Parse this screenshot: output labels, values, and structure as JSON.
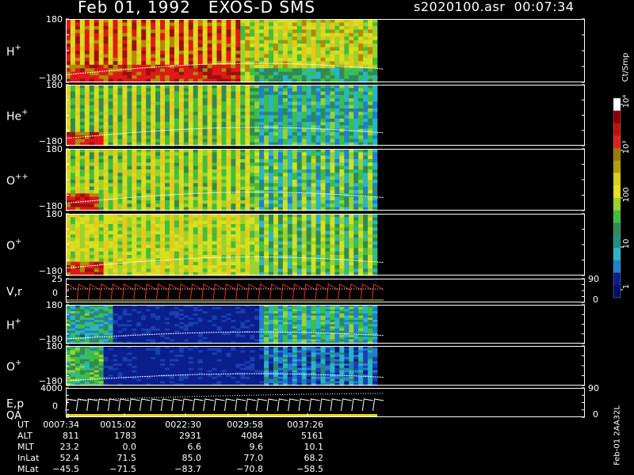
{
  "title": {
    "date": "Feb 01, 1992",
    "instrument": "EXOS-D SMS",
    "file": "s2020100.asr",
    "time": "00:07:34"
  },
  "colorbar": {
    "unit_label": "Ct/Smp",
    "tick_labels": [
      "1",
      "10",
      "100",
      "10³",
      "10⁴"
    ]
  },
  "chart_data": {
    "type": "heatmap",
    "panels": [
      {
        "name": "H+",
        "y_top": "180",
        "y_bottom": "−180"
      },
      {
        "name": "He+",
        "y_top": "180",
        "y_bottom": "−180"
      },
      {
        "name": "O++",
        "y_top": "180",
        "y_bottom": "−180"
      },
      {
        "name": "O+",
        "y_top": "180",
        "y_bottom": "−180"
      },
      {
        "name": "V,r",
        "y_top": "25",
        "y_mid": "0",
        "right_top": "90",
        "right_bottom": "0"
      },
      {
        "name": "H+",
        "y_top": "180",
        "y_bottom": "−180"
      },
      {
        "name": "O+",
        "y_top": "180",
        "y_bottom": "−180"
      },
      {
        "name": "E,p",
        "sub": "QA",
        "y_top": "4000",
        "y_mid": "0",
        "right_top": "90",
        "right_bottom": "0"
      }
    ],
    "time_axis": {
      "ticks": [
        "0007:34",
        "0015:02",
        "0022:30",
        "0029:58",
        "0037:26"
      ]
    },
    "orbit_table": {
      "rows": [
        {
          "label": "UT",
          "values": [
            "0007:34",
            "0015:02",
            "0022:30",
            "0029:58",
            "0037:26"
          ]
        },
        {
          "label": "ALT",
          "values": [
            "811",
            "1783",
            "2931",
            "4084",
            "5161"
          ]
        },
        {
          "label": "MLT",
          "values": [
            "23.2",
            "0.0",
            "6.6",
            "9.6",
            "10.1"
          ]
        },
        {
          "label": "InLat",
          "values": [
            "52.4",
            "71.5",
            "85.0",
            "77.0",
            "68.2"
          ]
        },
        {
          "label": "MLat",
          "values": [
            "−45.5",
            "−71.5",
            "−83.7",
            "−70.8",
            "−58.5"
          ]
        }
      ]
    }
  },
  "side_label": "Feb-01 2AA32L"
}
